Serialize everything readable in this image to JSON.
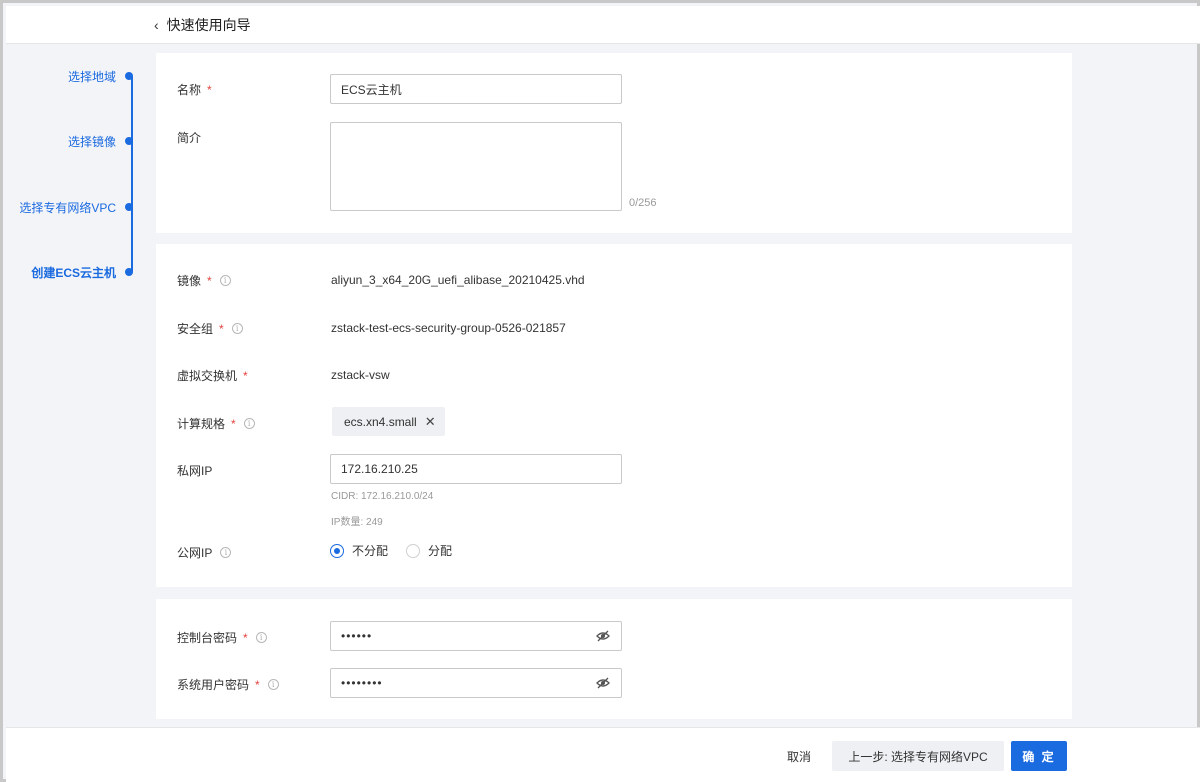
{
  "header": {
    "back_label": "快速使用向导"
  },
  "steps": [
    {
      "label": "选择地域"
    },
    {
      "label": "选择镜像"
    },
    {
      "label": "选择专有网络VPC"
    },
    {
      "label": "创建ECS云主机"
    }
  ],
  "basic": {
    "name_label": "名称",
    "name_value": "ECS云主机",
    "desc_label": "简介",
    "desc_value": "",
    "desc_counter": "0/256"
  },
  "config": {
    "image_label": "镜像",
    "image_value": "aliyun_3_x64_20G_uefi_alibase_20210425.vhd",
    "security_group_label": "安全组",
    "security_group_value": "zstack-test-ecs-security-group-0526-021857",
    "vswitch_label": "虚拟交换机",
    "vswitch_value": "zstack-vsw",
    "spec_label": "计算规格",
    "spec_value": "ecs.xn4.small",
    "private_ip_label": "私网IP",
    "private_ip_value": "172.16.210.25",
    "cidr_hint": "CIDR: 172.16.210.0/24",
    "ip_count_hint": "IP数量: 249",
    "public_ip_label": "公网IP",
    "public_ip_options": [
      "不分配",
      "分配"
    ],
    "public_ip_selected": "不分配"
  },
  "passwords": {
    "console_label": "控制台密码",
    "console_value": "••••••",
    "system_label": "系统用户密码",
    "system_value": "••••••••"
  },
  "footer": {
    "cancel_label": "取消",
    "prev_label": "上一步: 选择专有网络VPC",
    "ok_label": "确 定"
  },
  "colors": {
    "accent": "#1a6ae0",
    "required": "#e2433f"
  }
}
